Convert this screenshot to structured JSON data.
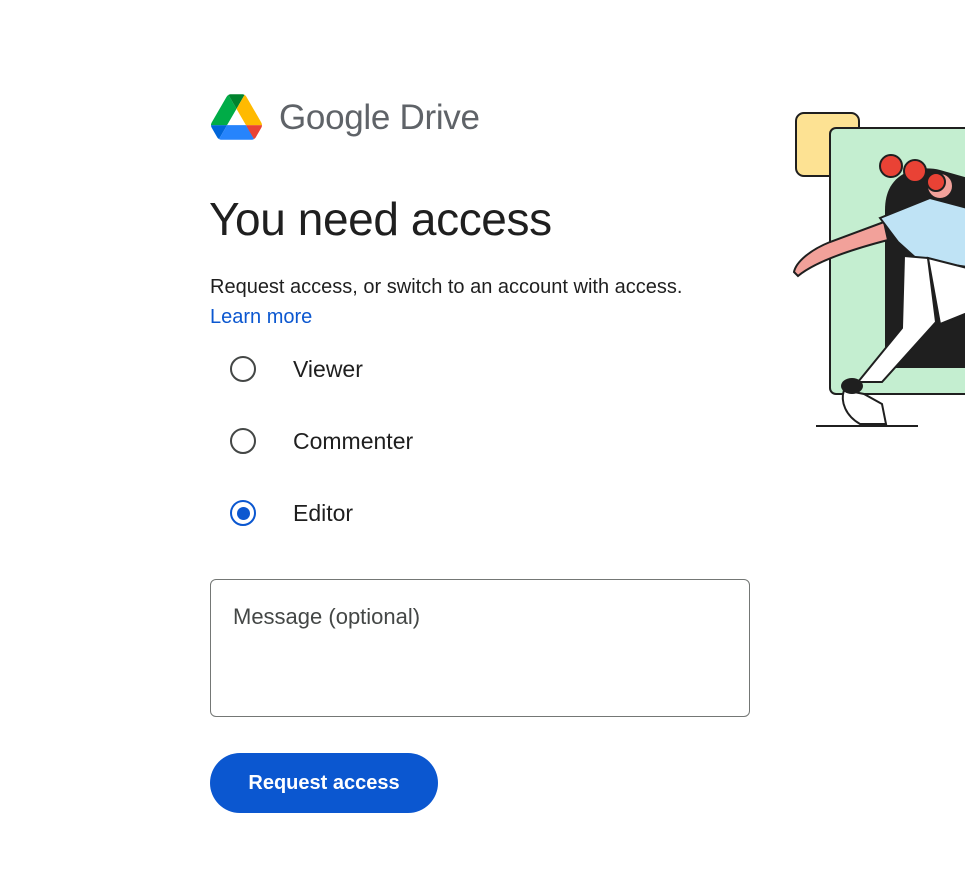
{
  "brand": {
    "name": "Google Drive",
    "logo_icon": "google-drive-logo-icon",
    "colors": {
      "green": "#00AC47",
      "yellow": "#FFBA00",
      "blue": "#2684FC",
      "darkgreen": "#00832D",
      "red": "#EA4335",
      "darkblue": "#0066DA"
    }
  },
  "main": {
    "title": "You need access",
    "subtitle": "Request access, or switch to an account with access.",
    "learn_more": "Learn more"
  },
  "roles": {
    "options": [
      {
        "label": "Viewer",
        "selected": false
      },
      {
        "label": "Commenter",
        "selected": false
      },
      {
        "label": "Editor",
        "selected": true
      }
    ]
  },
  "message": {
    "placeholder": "Message (optional)",
    "value": ""
  },
  "actions": {
    "request_label": "Request access"
  },
  "illustration": {
    "icon": "person-walking-through-door-illustration"
  },
  "colors": {
    "accent": "#0b57d0",
    "text": "#1f1f1f",
    "muted": "#5f6368"
  }
}
